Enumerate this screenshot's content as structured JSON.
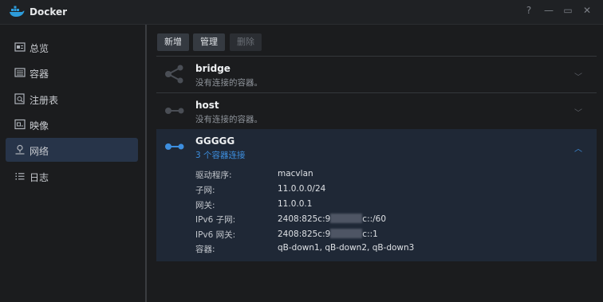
{
  "window": {
    "title": "Docker",
    "controls": {
      "help": "?",
      "minimize": "—",
      "maximize": "▭",
      "close": "✕"
    }
  },
  "sidebar": {
    "items": [
      {
        "label": "总览",
        "icon": "overview-icon",
        "active": false
      },
      {
        "label": "容器",
        "icon": "container-list-icon",
        "active": false
      },
      {
        "label": "注册表",
        "icon": "registry-search-icon",
        "active": false
      },
      {
        "label": "映像",
        "icon": "image-icon",
        "active": false
      },
      {
        "label": "网络",
        "icon": "network-icon",
        "active": true
      },
      {
        "label": "日志",
        "icon": "log-list-icon",
        "active": false
      }
    ]
  },
  "toolbar": {
    "new_label": "新增",
    "manage_label": "管理",
    "delete_label": "删除"
  },
  "networks": [
    {
      "name": "bridge",
      "subtitle": "没有连接的容器。",
      "icon": "bridge-network-icon",
      "expanded": false
    },
    {
      "name": "host",
      "subtitle": "没有连接的容器。",
      "icon": "host-network-icon",
      "expanded": false
    },
    {
      "name": "GGGGG",
      "subtitle": "3 个容器连接",
      "icon": "macvlan-network-icon",
      "expanded": true,
      "details": [
        {
          "key": "驱动程序:",
          "value": "macvlan"
        },
        {
          "key": "子网:",
          "value": "11.0.0.0/24"
        },
        {
          "key": "网关:",
          "value": "11.0.0.1"
        },
        {
          "key": "IPv6 子网:",
          "value_prefix": "2408:825c:9",
          "value_suffix": "c::/60"
        },
        {
          "key": "IPv6 网关:",
          "value_prefix": "2408:825c:9",
          "value_suffix": "c::1"
        },
        {
          "key": "容器:",
          "value": "qB-down1, qB-down2, qB-down3"
        }
      ]
    }
  ],
  "colors": {
    "accent": "#3d8fe0",
    "active_nav": "#273449",
    "expanded_bg": "#1f2836"
  }
}
